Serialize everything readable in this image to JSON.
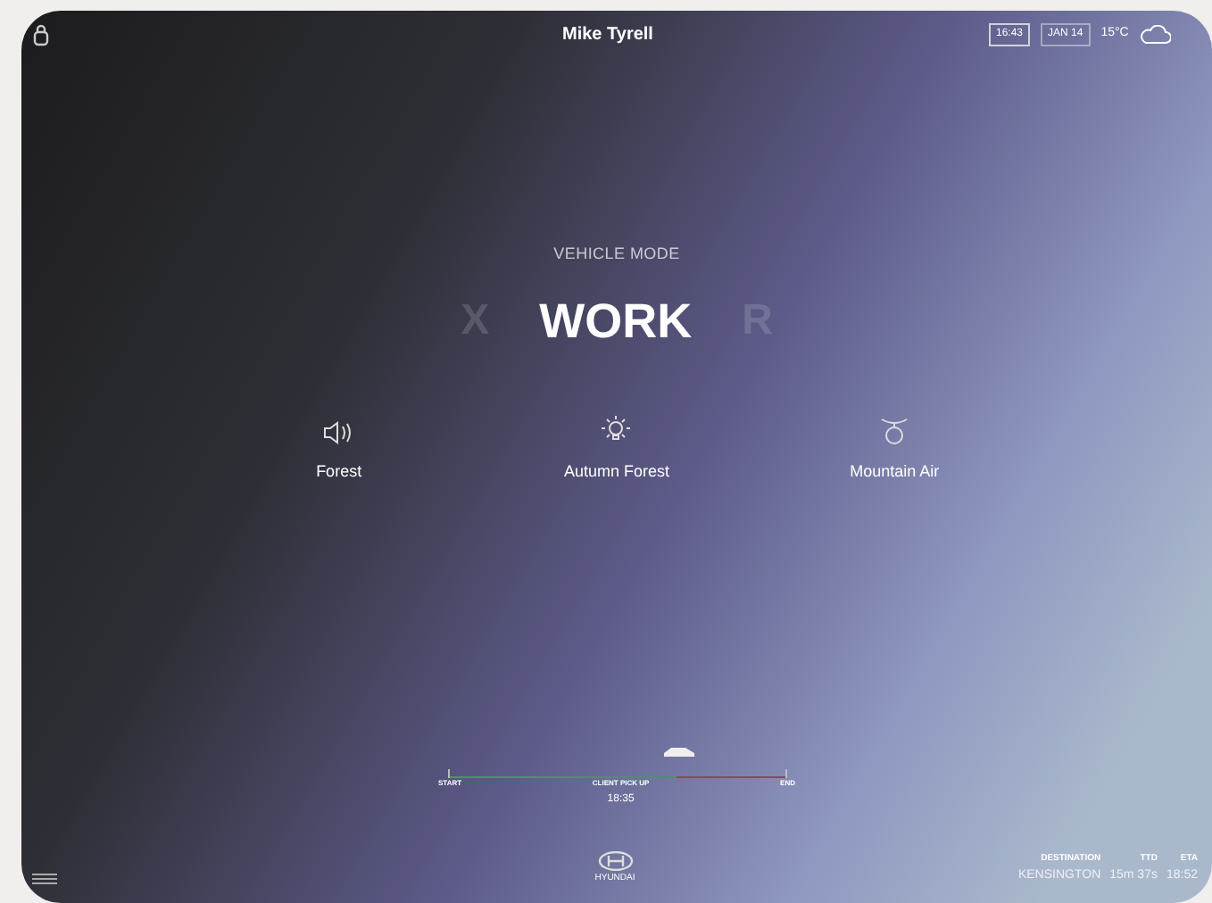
{
  "header": {
    "driver": "Mike Tyrell",
    "time": "16:43",
    "date": "JAN 14",
    "temperature": "15°C"
  },
  "vehicle_mode": {
    "label": "VEHICLE MODE",
    "modes": [
      {
        "name": "X",
        "selected": false
      },
      {
        "name": "WORK",
        "selected": true
      },
      {
        "name": "R",
        "selected": false
      }
    ]
  },
  "ambience": [
    {
      "kind": "sound",
      "label": "Forest"
    },
    {
      "kind": "light",
      "label": "Autumn Forest"
    },
    {
      "kind": "scent",
      "label": "Mountain Air"
    }
  ],
  "trip": {
    "start": "START",
    "pickup": "CLIENT PICK UP",
    "pickup_time": "18:35",
    "end": "END",
    "level": 0.68
  },
  "brand": "HYUNDAI",
  "destination": {
    "label": "DESTINATION",
    "value": "KENSINGTON",
    "ttd_label": "TTD",
    "ttd": "15m 37s",
    "eta_label": "ETA",
    "eta": "18:52"
  }
}
